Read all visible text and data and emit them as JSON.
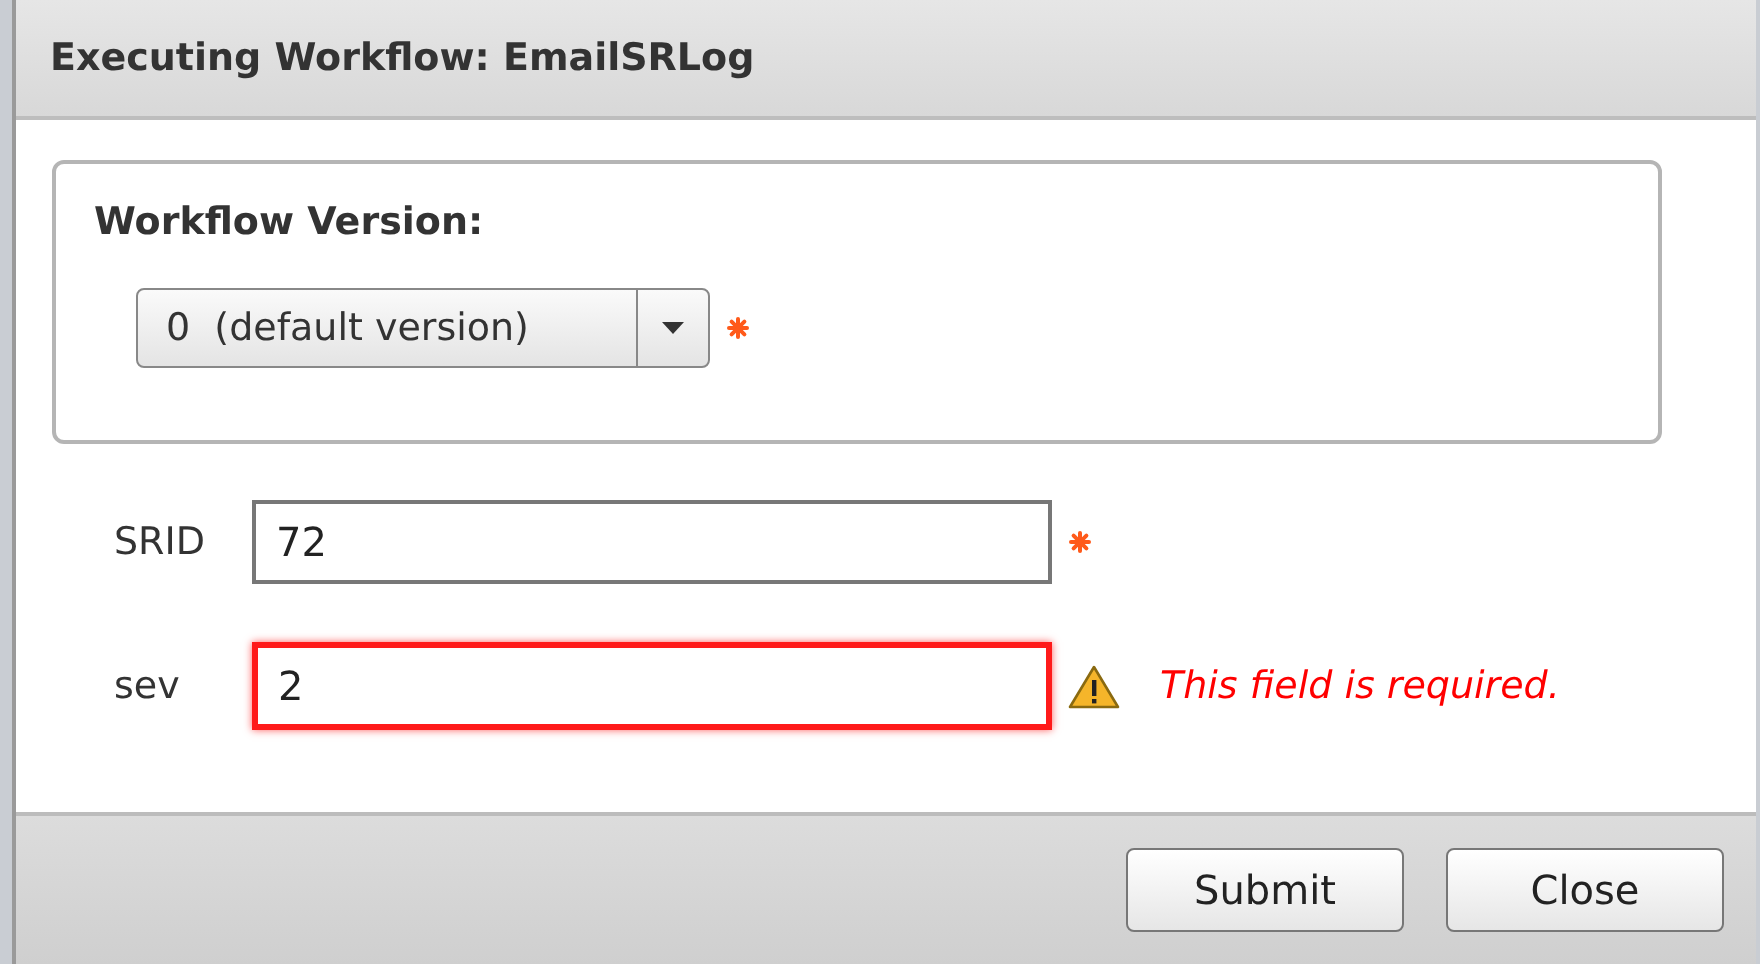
{
  "window": {
    "title": "Executing Workflow: EmailSRLog"
  },
  "version": {
    "label": "Workflow Version:",
    "value": "0  (default version)",
    "required": true
  },
  "fields": [
    {
      "label": "SRID",
      "value": "72",
      "required": true,
      "invalid": false
    },
    {
      "label": "sev",
      "value": "2",
      "required": false,
      "invalid": true,
      "error": "This field is required."
    }
  ],
  "buttons": [
    "Submit",
    "Close"
  ]
}
